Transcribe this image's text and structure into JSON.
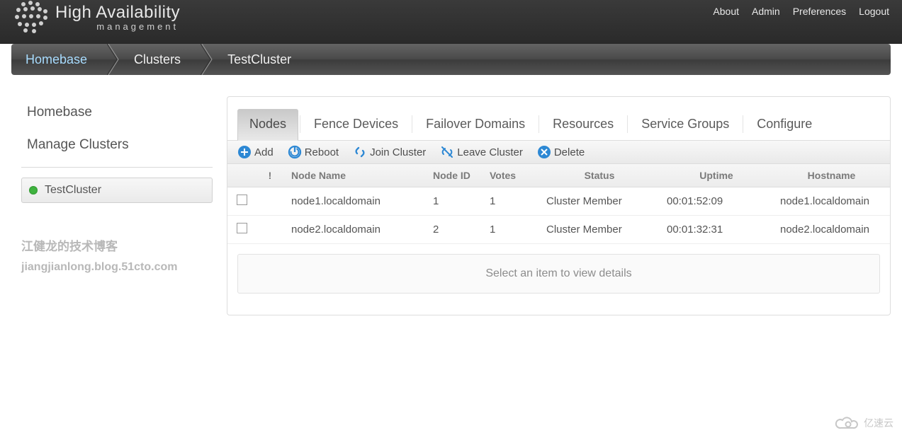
{
  "logo": {
    "title": "High Availability",
    "subtitle": "management"
  },
  "topnav": {
    "about": "About",
    "admin": "Admin",
    "preferences": "Preferences",
    "logout": "Logout"
  },
  "breadcrumb": {
    "homebase": "Homebase",
    "clusters": "Clusters",
    "current": "TestCluster"
  },
  "sidebar": {
    "homebase": "Homebase",
    "manage": "Manage Clusters",
    "cluster_name": "TestCluster"
  },
  "watermark": {
    "line1": "江健龙的技术博客",
    "line2": "jiangjianlong.blog.51cto.com"
  },
  "tabs": {
    "nodes": "Nodes",
    "fence": "Fence Devices",
    "failover": "Failover Domains",
    "resources": "Resources",
    "sg": "Service Groups",
    "configure": "Configure"
  },
  "toolbar": {
    "add": "Add",
    "reboot": "Reboot",
    "join": "Join Cluster",
    "leave": "Leave Cluster",
    "delete": "Delete"
  },
  "columns": {
    "alert": "!",
    "node_name": "Node Name",
    "node_id": "Node ID",
    "votes": "Votes",
    "status": "Status",
    "uptime": "Uptime",
    "hostname": "Hostname"
  },
  "rows": [
    {
      "name": "node1.localdomain",
      "id": "1",
      "votes": "1",
      "status": "Cluster Member",
      "uptime": "00:01:52:09",
      "hostname": "node1.localdomain"
    },
    {
      "name": "node2.localdomain",
      "id": "2",
      "votes": "1",
      "status": "Cluster Member",
      "uptime": "00:01:32:31",
      "hostname": "node2.localdomain"
    }
  ],
  "details_hint": "Select an item to view details",
  "footer_watermark": "亿速云"
}
